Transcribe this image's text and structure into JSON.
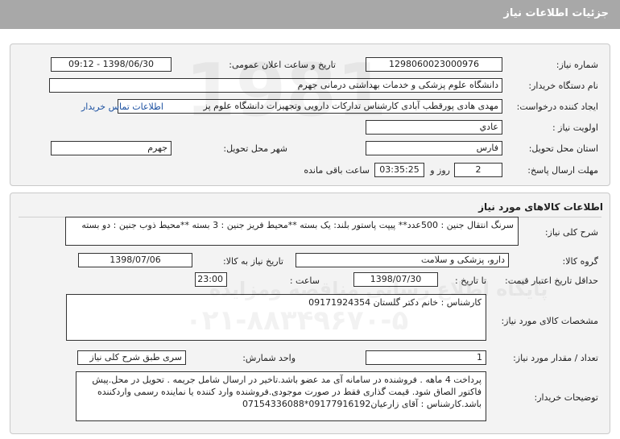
{
  "header": {
    "title": "جزئیات اطلاعات نیاز"
  },
  "general": {
    "need_number_label": "شماره نیاز:",
    "need_number": "1298060023000976",
    "announce_label": "تاریخ و ساعت اعلان عمومی:",
    "announce_value": "1398/06/30 - 09:12",
    "buyer_org_label": "نام دستگاه خریدار:",
    "buyer_org": "دانشگاه علوم پزشکی و خدمات بهداشتی درمانی جهرم",
    "creator_label": "ایجاد کننده درخواست:",
    "creator": "مهدی هادی پورقطب آبادی کارشناس تدارکات دارویی وتجهیزات دانشگاه علوم پز",
    "contact_link": "اطلاعات تماس خریدار",
    "priority_label": "اولویت نیاز :",
    "priority": "عادي",
    "province_label": "استان محل تحویل:",
    "province": "فارس",
    "city_label": "شهر محل تحویل:",
    "city": "جهرم",
    "deadline_label": "مهلت ارسال پاسخ:",
    "days": "2",
    "days_suffix": "روز و",
    "time_left": "03:35:25",
    "time_suffix": "ساعت باقی مانده"
  },
  "goods": {
    "section_title": "اطلاعات کالاهای مورد نیاز",
    "summary_label": "شرح کلی نیاز:",
    "summary": "سرنگ انتقال جنین : 500عدد** پیپت پاستور بلند: یک بسته **محیط فریز جنین : 3 بسته **محیط ذوب جنین : دو بسته",
    "group_label": "گروه کالا:",
    "group": "دارو، پزشکی و سلامت",
    "need_date_label": "تاریخ نیاز به کالا:",
    "need_date": "1398/07/06",
    "validity_label": "حداقل تاریخ اعتبار قیمت:",
    "until_label": "تا تاریخ :",
    "validity_date": "1398/07/30",
    "hour_label": "ساعت :",
    "validity_time": "23:00",
    "specs_label": "مشخصات کالای مورد نیاز:",
    "specs": "کارشناس : خانم دکتر گلستان 09171924354",
    "qty_label": "تعداد / مقدار مورد نیاز:",
    "qty": "1",
    "unit_label": "واحد شمارش:",
    "unit": "سری طبق شرح کلی نیاز",
    "buyer_notes_label": "توضیحات خریدار:",
    "buyer_notes": "پرداخت 4 ماهه . فروشنده در سامانه آی مد عضو باشد.تاخیر در ارسال شامل جریمه  . تحویل در محل.پیش فاکتور الصاق شود. قیمت گذاری فقط در صورت موجودی.فروشنده وارد کننده یا نماینده رسمی واردکننده باشد.کارشناس : آقای زارعیان09177916192*07154336088"
  },
  "watermark": {
    "line1": "پایگاه اطلاع رسانی مناقصه ومزایده",
    "line2": "۰۲۱-۸۸۳۴۹۶۷۰-۵"
  }
}
